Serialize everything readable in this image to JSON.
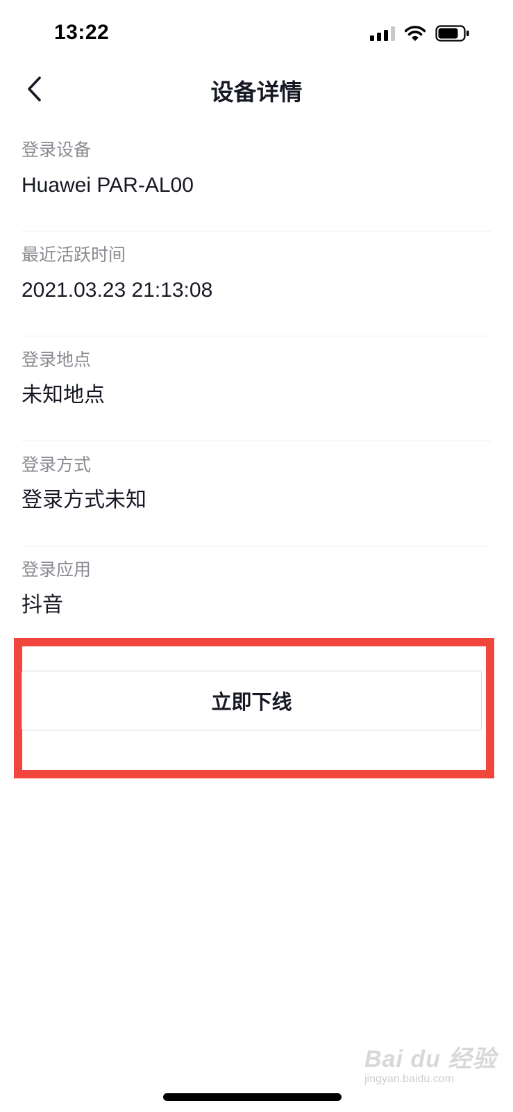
{
  "status_bar": {
    "time": "13:22",
    "icons": [
      "cellular-signal-icon",
      "wifi-icon",
      "battery-icon"
    ],
    "battery_level": 0.8
  },
  "nav": {
    "back_icon": "chevron-left-icon",
    "title": "设备详情"
  },
  "details": [
    {
      "label": "登录设备",
      "value": "Huawei PAR-AL00"
    },
    {
      "label": "最近活跃时间",
      "value": "2021.03.23 21:13:08"
    },
    {
      "label": "登录地点",
      "value": "未知地点"
    },
    {
      "label": "登录方式",
      "value": "登录方式未知"
    },
    {
      "label": "登录应用",
      "value": "抖音"
    }
  ],
  "action": {
    "offline_label": "立即下线"
  },
  "watermark": {
    "text": "Bai du 经验",
    "sub": "jingyan.baidu.com"
  },
  "colors": {
    "highlight": "#f0463c",
    "label_gray": "#8a8b91",
    "text": "#161823"
  }
}
